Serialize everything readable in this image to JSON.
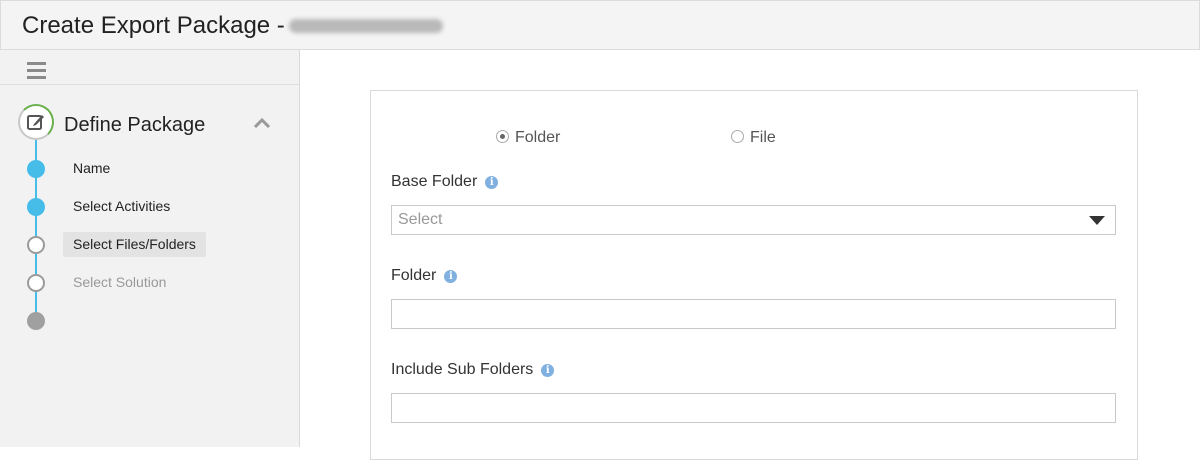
{
  "header": {
    "title": "Create Export Package -"
  },
  "sidebar": {
    "section_title": "Define Package",
    "steps": [
      {
        "label": "Name",
        "state": "done"
      },
      {
        "label": "Select Activities",
        "state": "done"
      },
      {
        "label": "Select Files/Folders",
        "state": "active"
      },
      {
        "label": "Select Solution",
        "state": "disabled"
      }
    ]
  },
  "form": {
    "type_options": [
      "Folder",
      "File"
    ],
    "type_selected": "Folder",
    "base_folder_label": "Base Folder",
    "base_folder_placeholder": "Select",
    "folder_label": "Folder",
    "folder_value": "",
    "include_sub_label": "Include Sub Folders",
    "include_sub_value": ""
  },
  "colors": {
    "accent": "#46bde8",
    "progress": "#6ab04c",
    "info": "#7fb0e0"
  },
  "icons": {
    "menu": "hamburger-icon",
    "section": "edit-icon",
    "collapse": "chevron-up-icon",
    "info": "info-icon",
    "dropdown": "caret-down-icon"
  }
}
